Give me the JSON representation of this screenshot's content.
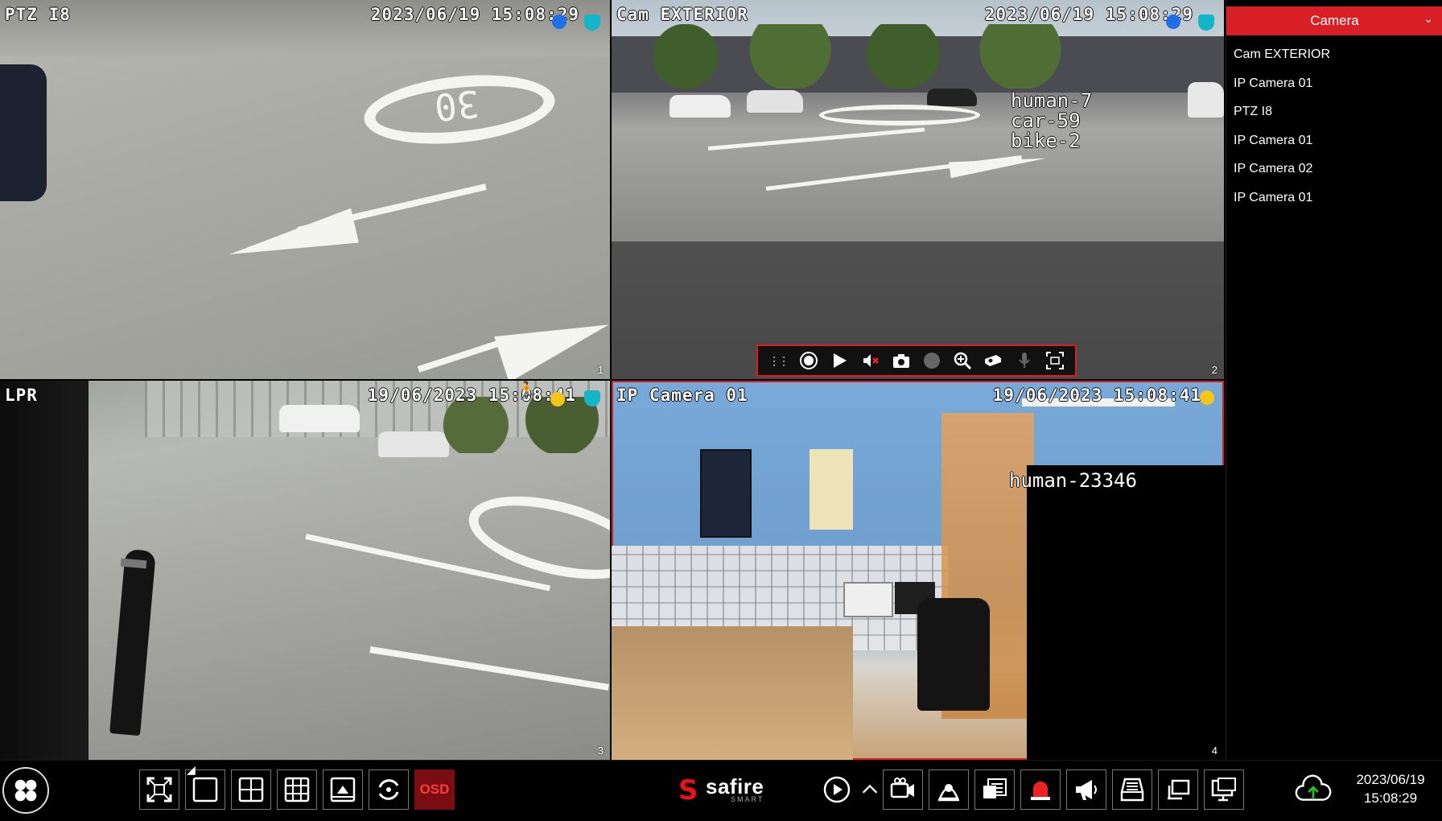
{
  "tiles": [
    {
      "id": 1,
      "name": "PTZ I8",
      "timestamp": "2023/06/19 15:08:29",
      "number": "1",
      "road_marking": "30"
    },
    {
      "id": 2,
      "name": "Cam EXTERIOR",
      "timestamp": "2023/06/19 15:08:29",
      "number": "2",
      "counters": [
        "human-7",
        "car-59",
        "bike-2"
      ]
    },
    {
      "id": 3,
      "name": "LPR",
      "timestamp": "19/06/2023 15:08:41",
      "number": "3"
    },
    {
      "id": 4,
      "name": "IP Camera 01",
      "timestamp": "19/06/2023 15:08:41",
      "number": "4",
      "counters": [
        "human-23346"
      ]
    }
  ],
  "ptz_toolbar": {
    "icons": [
      "drag-handle-icon",
      "record-icon",
      "play-icon",
      "mute-icon",
      "snapshot-icon",
      "talk-icon",
      "zoom-icon",
      "ptz-icon",
      "microphone-icon",
      "face-capture-icon"
    ]
  },
  "side_panel": {
    "header": "Camera",
    "cameras": [
      "Cam EXTERIOR",
      "IP Camera 01",
      "PTZ I8",
      "IP Camera 01",
      "IP Camera 02",
      "IP Camera 01"
    ]
  },
  "bottom_bar": {
    "osd_label": "OSD",
    "logo_brand": "safire",
    "logo_sub": "SMART",
    "date": "2023/06/19",
    "time": "15:08:29"
  },
  "colors": {
    "accent": "#d81f26",
    "detection_blue": "#1e6fe8",
    "alarm_yellow": "#f5c518",
    "shield_cyan": "#13b5c8"
  }
}
